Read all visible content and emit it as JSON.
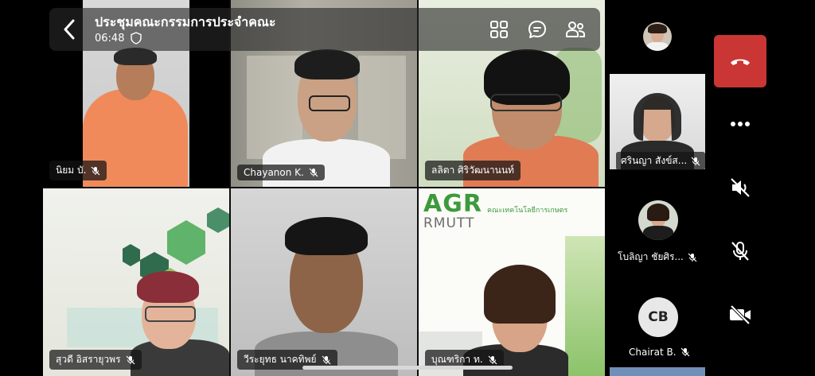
{
  "header": {
    "title": "ประชุมคณะกรรมการประจำคณะ",
    "time": "06:48"
  },
  "participants": [
    {
      "name": "นิยม บั."
    },
    {
      "name": "Chayanon K."
    },
    {
      "name": "ลลิตา  ศิริวัฒนานนท์"
    },
    {
      "name": "สุวดี  อิสรายุวพร"
    },
    {
      "name": "วีระยุทธ  นาคทิพย์"
    },
    {
      "name": "บุณฑริกา ท."
    }
  ],
  "slide": {
    "brand_big": "AGR",
    "brand_sub": "RMUTT",
    "tagline": "คณะเทคโนโลยีการเกษตร"
  },
  "rail": [
    {
      "name": "ศรินญา  สังข์ส..."
    },
    {
      "name": "โบลิญา  ชัยศิร..."
    },
    {
      "name": "Chairat B.",
      "initials": "CB"
    }
  ],
  "icons": {
    "back": "chevron-left-icon",
    "shield": "shield-icon",
    "grid": "grid-view-icon",
    "chat": "chat-icon",
    "people": "participants-icon",
    "end": "end-call-icon",
    "more": "more-icon",
    "speaker": "speaker-off-icon",
    "mic": "mic-off-icon",
    "camera": "camera-off-icon"
  },
  "colors": {
    "end_call": "#c93634",
    "agr_green": "#3c9a3c"
  }
}
